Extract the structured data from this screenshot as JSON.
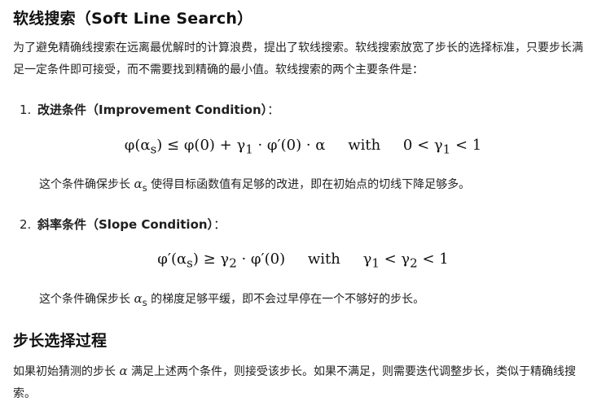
{
  "heading_soft": "软线搜索（Soft Line Search）",
  "intro": "为了避免精确线搜索在远离最优解时的计算浪费，提出了软线搜索。软线搜索放宽了步长的选择标准，只要步长满足一定条件即可接受，而不需要找到精确的最小值。软线搜索的两个主要条件是：",
  "items": [
    {
      "number": "1.",
      "title": "改进条件（Improvement Condition）",
      "suffix": "：",
      "formula_lhs": "φ(α",
      "formula_lhs_sub": "s",
      "formula_main": ") ≤ φ(0) + γ",
      "formula_main_sub": "1",
      "formula_tail": " · φ′(0) · α",
      "with_word": "with",
      "cond_pre": "0 < γ",
      "cond_sub": "1",
      "cond_post": " < 1",
      "note_pre": "这个条件确保步长 ",
      "note_var": "α",
      "note_var_sub": "s",
      "note_post": " 使得目标函数值有足够的改进，即在初始点的切线下降足够多。"
    },
    {
      "number": "2.",
      "title": "斜率条件（Slope Condition）",
      "suffix": "：",
      "formula_lhs": "φ′(α",
      "formula_lhs_sub": "s",
      "formula_main": ") ≥ γ",
      "formula_main_sub": "2",
      "formula_tail": " · φ′(0)",
      "with_word": "with",
      "cond_pre": "γ",
      "cond_sub": "1",
      "cond_mid": " < γ",
      "cond_sub2": "2",
      "cond_post": " < 1",
      "note_pre": "这个条件确保步长 ",
      "note_var": "α",
      "note_var_sub": "s",
      "note_post": " 的梯度足够平缓，即不会过早停在一个不够好的步长。"
    }
  ],
  "heading_proc": "步长选择过程",
  "proc_pre": "如果初始猜测的步长 ",
  "proc_var": "α",
  "proc_post": " 满足上述两个条件，则接受该步长。如果不满足，则需要迭代调整步长，类似于精确线搜索。"
}
